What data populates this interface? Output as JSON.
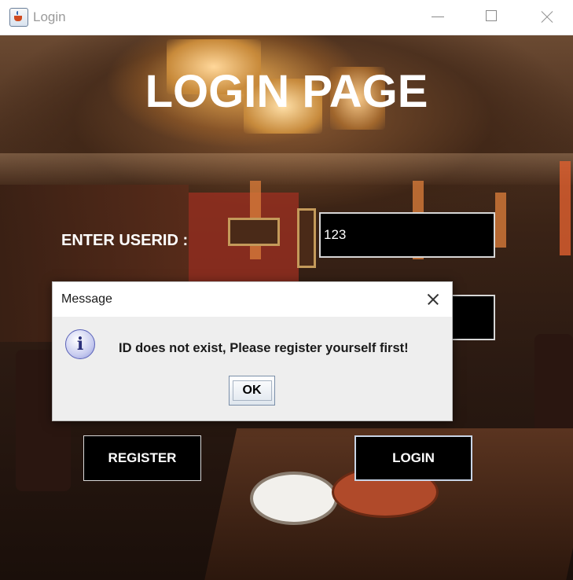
{
  "window": {
    "title": "Login",
    "icon": "java-app-icon",
    "controls": [
      "minimize-icon",
      "maximize-icon",
      "close-icon"
    ]
  },
  "page": {
    "title": "LOGIN PAGE",
    "userid_label": "ENTER USERID :",
    "userid_value": "123",
    "password_value": "",
    "register_label": "REGISTER",
    "login_label": "LOGIN"
  },
  "dialog": {
    "title": "Message",
    "icon": "info-icon",
    "icon_glyph": "i",
    "message": "ID does not exist, Please register yourself first!",
    "ok_label": "OK"
  },
  "colors": {
    "field_background": "#000000",
    "button_background": "#000000",
    "text": "#ffffff",
    "dialog_background": "#eeeeee"
  }
}
